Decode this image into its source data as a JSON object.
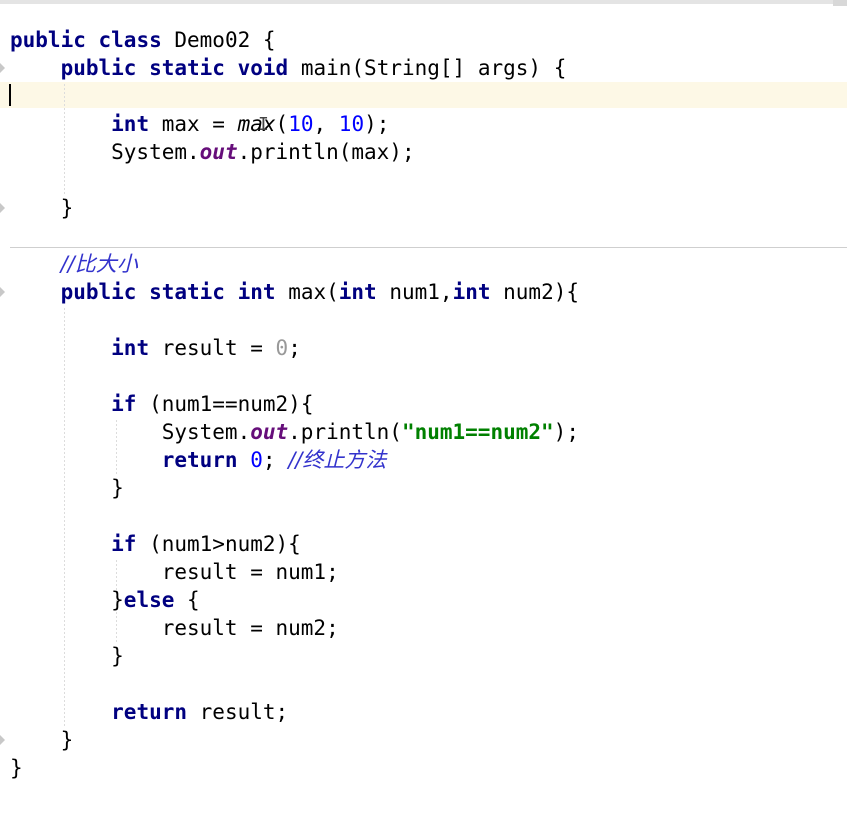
{
  "editor": {
    "lines": [
      {
        "tokens": [
          {
            "t": "public",
            "k": "kw"
          },
          {
            "t": " "
          },
          {
            "t": "class",
            "k": "kw"
          },
          {
            "t": " Demo02 {"
          }
        ]
      },
      {
        "tokens": [
          {
            "t": "    "
          },
          {
            "t": "public",
            "k": "kw"
          },
          {
            "t": " "
          },
          {
            "t": "static",
            "k": "kw"
          },
          {
            "t": " "
          },
          {
            "t": "void",
            "k": "kw"
          },
          {
            "t": " main(String[] args) {"
          }
        ]
      },
      {
        "tokens": []
      },
      {
        "tokens": [
          {
            "t": "        "
          },
          {
            "t": "int",
            "k": "kw"
          },
          {
            "t": " max = "
          },
          {
            "t": "max",
            "k": "call"
          },
          {
            "t": "("
          },
          {
            "t": "10",
            "k": "num"
          },
          {
            "t": ", "
          },
          {
            "t": "10",
            "k": "num"
          },
          {
            "t": ");"
          }
        ]
      },
      {
        "tokens": [
          {
            "t": "        System."
          },
          {
            "t": "out",
            "k": "field"
          },
          {
            "t": ".println(max);"
          }
        ]
      },
      {
        "tokens": []
      },
      {
        "tokens": [
          {
            "t": "    }"
          }
        ]
      },
      {
        "tokens": []
      },
      {
        "tokens": [
          {
            "t": "    "
          },
          {
            "t": "//比大小",
            "k": "cmt"
          }
        ]
      },
      {
        "tokens": [
          {
            "t": "    "
          },
          {
            "t": "public",
            "k": "kw"
          },
          {
            "t": " "
          },
          {
            "t": "static",
            "k": "kw"
          },
          {
            "t": " "
          },
          {
            "t": "int",
            "k": "kw"
          },
          {
            "t": " max("
          },
          {
            "t": "int",
            "k": "kw"
          },
          {
            "t": " num1,"
          },
          {
            "t": "int",
            "k": "kw"
          },
          {
            "t": " num2){"
          }
        ]
      },
      {
        "tokens": []
      },
      {
        "tokens": [
          {
            "t": "        "
          },
          {
            "t": "int",
            "k": "kw"
          },
          {
            "t": " result = "
          },
          {
            "t": "0",
            "k": "zero"
          },
          {
            "t": ";"
          }
        ]
      },
      {
        "tokens": []
      },
      {
        "tokens": [
          {
            "t": "        "
          },
          {
            "t": "if",
            "k": "kw"
          },
          {
            "t": " (num1==num2){"
          }
        ]
      },
      {
        "tokens": [
          {
            "t": "            System."
          },
          {
            "t": "out",
            "k": "field"
          },
          {
            "t": ".println("
          },
          {
            "t": "\"num1==num2\"",
            "k": "str"
          },
          {
            "t": ");"
          }
        ]
      },
      {
        "tokens": [
          {
            "t": "            "
          },
          {
            "t": "return",
            "k": "kw"
          },
          {
            "t": " "
          },
          {
            "t": "0",
            "k": "num"
          },
          {
            "t": "; "
          },
          {
            "t": "//终止方法",
            "k": "cmt"
          }
        ]
      },
      {
        "tokens": [
          {
            "t": "        }"
          }
        ]
      },
      {
        "tokens": []
      },
      {
        "tokens": [
          {
            "t": "        "
          },
          {
            "t": "if",
            "k": "kw"
          },
          {
            "t": " (num1>num2){"
          }
        ]
      },
      {
        "tokens": [
          {
            "t": "            result = num1;"
          }
        ]
      },
      {
        "tokens": [
          {
            "t": "        }"
          },
          {
            "t": "else",
            "k": "kw"
          },
          {
            "t": " {"
          }
        ]
      },
      {
        "tokens": [
          {
            "t": "            result = num2;"
          }
        ]
      },
      {
        "tokens": [
          {
            "t": "        }"
          }
        ]
      },
      {
        "tokens": []
      },
      {
        "tokens": [
          {
            "t": "        "
          },
          {
            "t": "return",
            "k": "kw"
          },
          {
            "t": " result;"
          }
        ]
      },
      {
        "tokens": [
          {
            "t": "    }"
          }
        ]
      },
      {
        "tokens": [
          {
            "t": "}"
          }
        ]
      }
    ],
    "caret_line": 3,
    "mouse_cursor": "text-cursor-icon"
  },
  "colors": {
    "keyword": "#000080",
    "number": "#0000ff",
    "string": "#008000",
    "field": "#660e7a",
    "comment": "#3333cc",
    "caret_line_bg": "#fdf8e6"
  }
}
